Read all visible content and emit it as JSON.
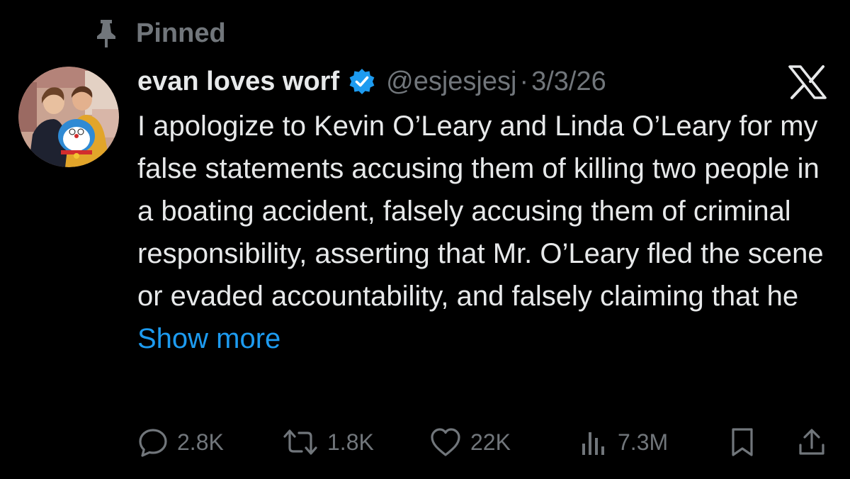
{
  "pinned": {
    "label": "Pinned",
    "icon": "pin-icon"
  },
  "author": {
    "display_name": "evan loves worf",
    "verified": true,
    "verified_color": "#1d9bf0",
    "handle": "@esjesjesj",
    "separator": "·",
    "date": "3/3/26"
  },
  "tweet": {
    "text": "I apologize to Kevin O’Leary and Linda O’Leary for my false statements accusing them of killing two people in a boating accident, falsely accusing them of criminal responsibility, asserting that Mr. O’Leary fled the scene or evaded accountability, and falsely claiming that he ",
    "show_more": "Show more"
  },
  "brand": {
    "icon": "x-logo-icon"
  },
  "actions": {
    "reply": {
      "icon": "reply-icon",
      "count": "2.8K"
    },
    "retweet": {
      "icon": "retweet-icon",
      "count": "1.8K"
    },
    "like": {
      "icon": "heart-icon",
      "count": "22K"
    },
    "views": {
      "icon": "views-icon",
      "count": "7.3M"
    },
    "bookmark": {
      "icon": "bookmark-icon"
    },
    "share": {
      "icon": "share-icon"
    }
  },
  "colors": {
    "background": "#000000",
    "text_primary": "#e7e9ea",
    "text_secondary": "#71767b",
    "link": "#1d9bf0"
  }
}
